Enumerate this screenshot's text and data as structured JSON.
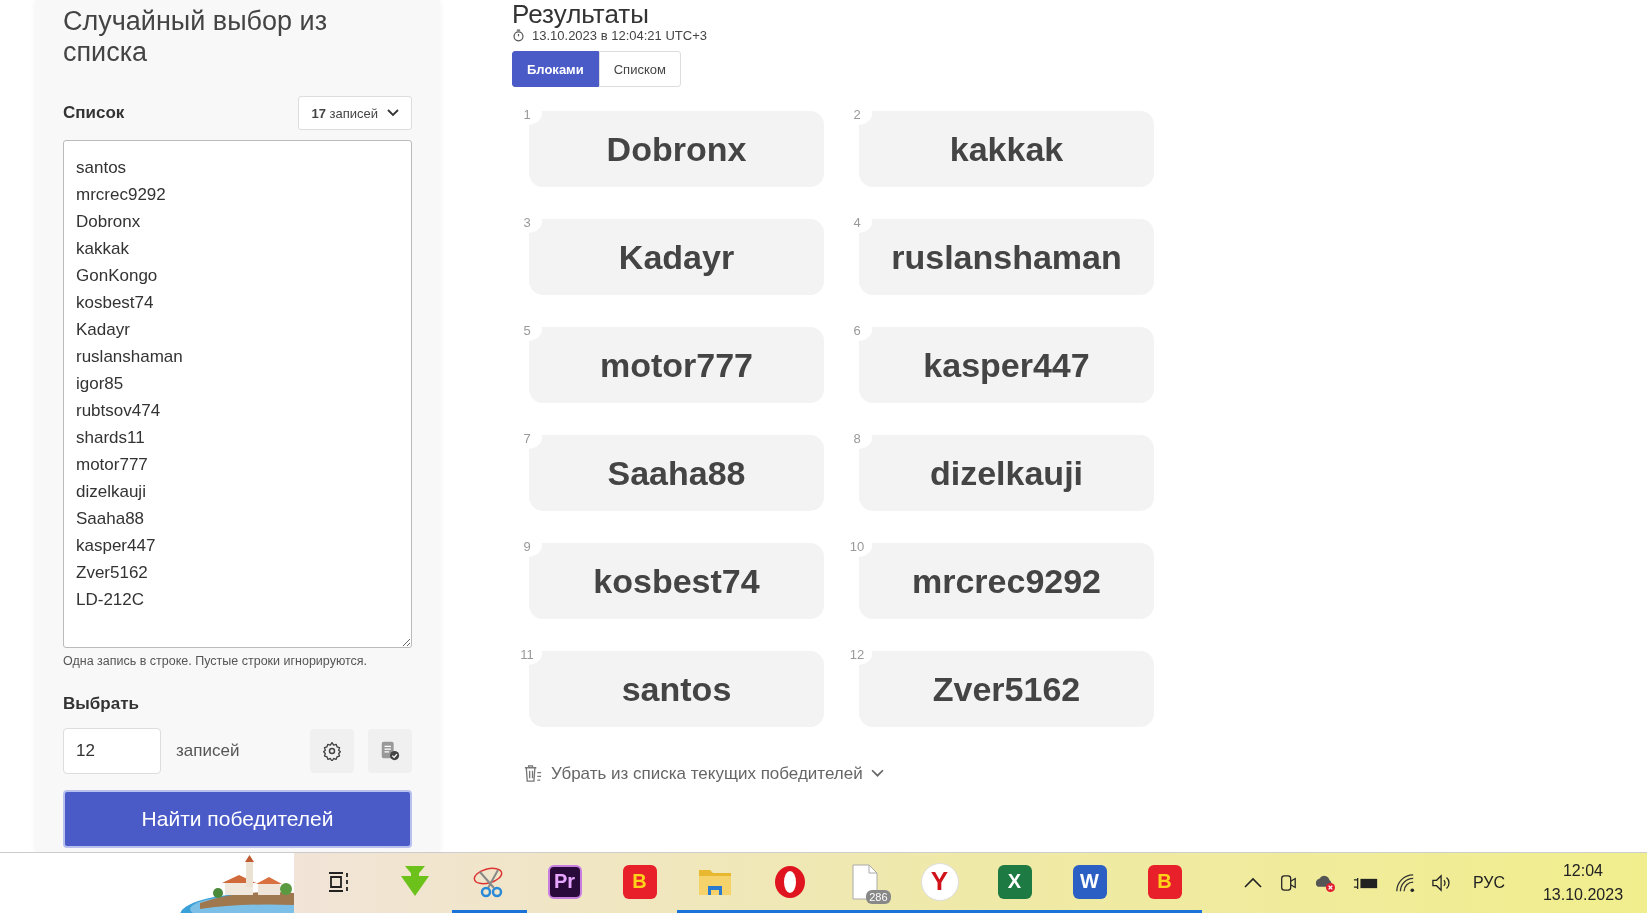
{
  "sidebar": {
    "title": "Случайный выбор из списка",
    "list_label": "Список",
    "count_dropdown": "**17** записей",
    "entries": [
      "santos",
      "mrcrec9292",
      "Dobronx",
      "kakkak",
      "GonKongo",
      "kosbest74",
      "Kadayr",
      "ruslanshaman",
      "igor85",
      "rubtsov474",
      "shards11",
      "motor777",
      "dizelkauji",
      "Saaha88",
      "kasper447",
      "Zver5162",
      "LD-212C"
    ],
    "hint": "Одна запись в строке. Пустые строки игнорируются.",
    "pick_label": "Выбрать",
    "pick_value": "12",
    "pick_unit": "записей",
    "submit": "Найти победителей"
  },
  "results": {
    "title": "Результаты",
    "timestamp": "13.10.2023 в 12:04:21 UTC+3",
    "tabs": [
      {
        "label": "Блоками",
        "selected": true
      },
      {
        "label": "Списком",
        "selected": false
      }
    ],
    "winners": [
      {
        "number": "1",
        "name": "Dobronx"
      },
      {
        "number": "2",
        "name": "kakkak"
      },
      {
        "number": "3",
        "name": "Kadayr"
      },
      {
        "number": "4",
        "name": "ruslanshaman"
      },
      {
        "number": "5",
        "name": "motor777"
      },
      {
        "number": "6",
        "name": "kasper447"
      },
      {
        "number": "7",
        "name": "Saaha88"
      },
      {
        "number": "8",
        "name": "dizelkauji"
      },
      {
        "number": "9",
        "name": "kosbest74"
      },
      {
        "number": "10",
        "name": "mrcrec9292"
      },
      {
        "number": "11",
        "name": "santos"
      },
      {
        "number": "12",
        "name": "Zver5162"
      }
    ],
    "remove_action": "Убрать из списка текущих победителей"
  },
  "taskbar": {
    "apps": [
      {
        "kind": "taskview",
        "running": false
      },
      {
        "kind": "download",
        "running": false
      },
      {
        "kind": "scissors",
        "running": true
      },
      {
        "kind": "lilactile",
        "label": "Pr",
        "color": "#2a0a3a",
        "running": false
      },
      {
        "kind": "goldtile",
        "label": "B",
        "color": "#e8202a",
        "running": false
      },
      {
        "kind": "folder",
        "running": true
      },
      {
        "kind": "opera",
        "running": true
      },
      {
        "kind": "file",
        "badge": "286",
        "running": true
      },
      {
        "kind": "round",
        "label": "Y",
        "running": true
      },
      {
        "kind": "tile",
        "label": "X",
        "color": "#1d7a43",
        "running": true
      },
      {
        "kind": "tile",
        "label": "W",
        "color": "#2b5fc4",
        "running": true
      },
      {
        "kind": "goldtile",
        "label": "B",
        "color": "#e8202a",
        "running": true
      }
    ],
    "language": "РУС",
    "time": "12:04",
    "date": "13.10.2023"
  }
}
